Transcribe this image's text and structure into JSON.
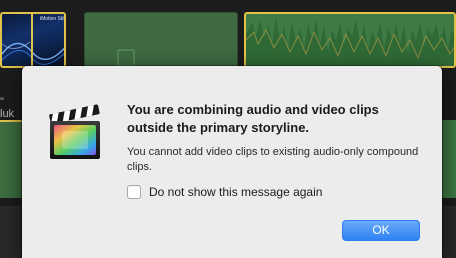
{
  "timeline": {
    "clip_label": "iMotion Stil",
    "side_text": "\" luk"
  },
  "dialog": {
    "title": "You are combining audio and video clips outside the primary storyline.",
    "message": "You cannot add video clips to existing audio-only compound clips.",
    "suppress_label": "Do not show this message again",
    "suppress_checked": false,
    "ok_label": "OK",
    "icon": "final-cut-pro-app-icon"
  },
  "colors": {
    "accent": "#2f82f2",
    "clip_selection": "#e2c34a",
    "audio_clip": "#3d7a44",
    "dialog_bg": "#ececec"
  }
}
